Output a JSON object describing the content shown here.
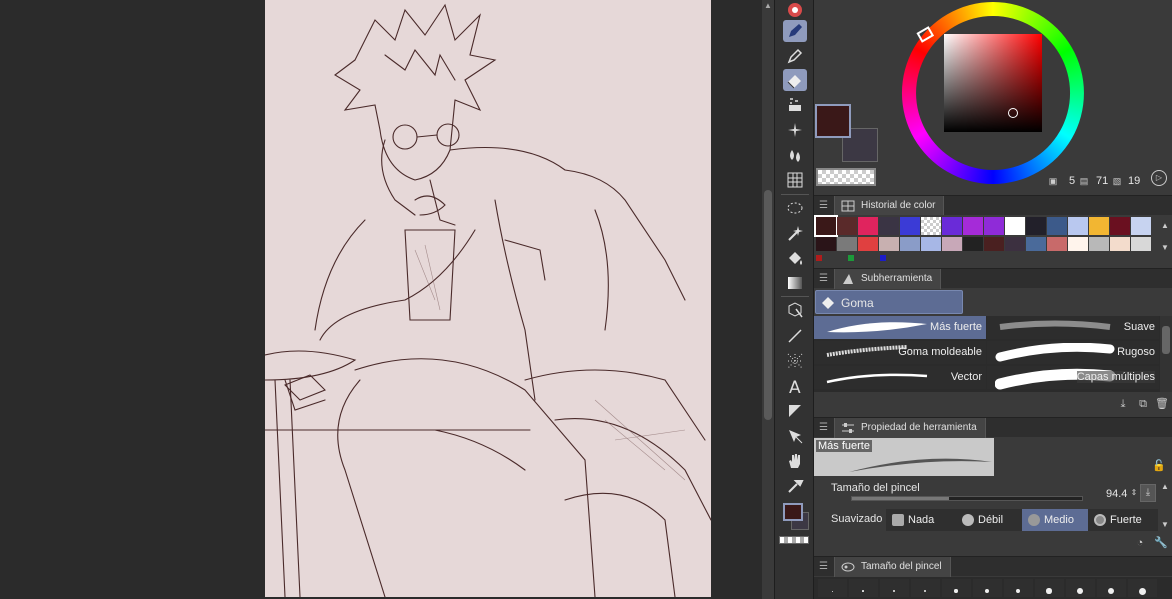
{
  "color_panel": {
    "main_color": "#3a1818",
    "sub_color": "#3c3844",
    "hue_marker_color": "#ff3b3b",
    "status_values": [
      "5",
      "71",
      "19"
    ]
  },
  "color_history": {
    "title": "Historial de color",
    "row1": [
      "#3a1818",
      "#5a2a2a",
      "#e0245e",
      "#3a3444",
      "#3b3bd6",
      "transparent",
      "#6a2bd8",
      "#a52bd8",
      "#8f2bd8",
      "#ffffff",
      "#22202a",
      "#3c5a8a",
      "#b9c8ef",
      "#f2b632",
      "#6a1020",
      "#c7d3f0"
    ],
    "row2": [
      "#2a1418",
      "#7a7a7a",
      "#e04040",
      "#c8b0b0",
      "#8a9cc8",
      "#a7b7e6",
      "#c8a8b8",
      "#222222",
      "#4a2020",
      "#3c3040",
      "#4a6a9a",
      "#c86a6a",
      "#fff4ec",
      "#b8b8b8",
      "#f3dccc",
      "#d8d8d8"
    ],
    "row3": [
      "#b01c1c",
      "#1c9a3a",
      "#1c1cc8"
    ]
  },
  "subtool": {
    "title": "Subherramienta",
    "group_label": "Goma",
    "brushes": [
      {
        "label": "Más fuerte",
        "selected": true
      },
      {
        "label": "Suave",
        "selected": false
      },
      {
        "label": "Goma moldeable",
        "selected": false
      },
      {
        "label": "Rugoso",
        "selected": false
      },
      {
        "label": "Vector",
        "selected": false
      },
      {
        "label": "Capas múltiples",
        "selected": false
      }
    ]
  },
  "tool_property": {
    "title": "Propiedad de herramienta",
    "preview_label": "Más fuerte",
    "brush_size_label": "Tamaño del pincel",
    "brush_size_value": "94.4",
    "brush_size_fraction": 0.42,
    "smoothing_label": "Suavizado",
    "smoothing_options": [
      "Nada",
      "Débil",
      "Medio",
      "Fuerte"
    ],
    "smoothing_selected": "Medio"
  },
  "brush_size_panel": {
    "title": "Tamaño del pincel"
  }
}
